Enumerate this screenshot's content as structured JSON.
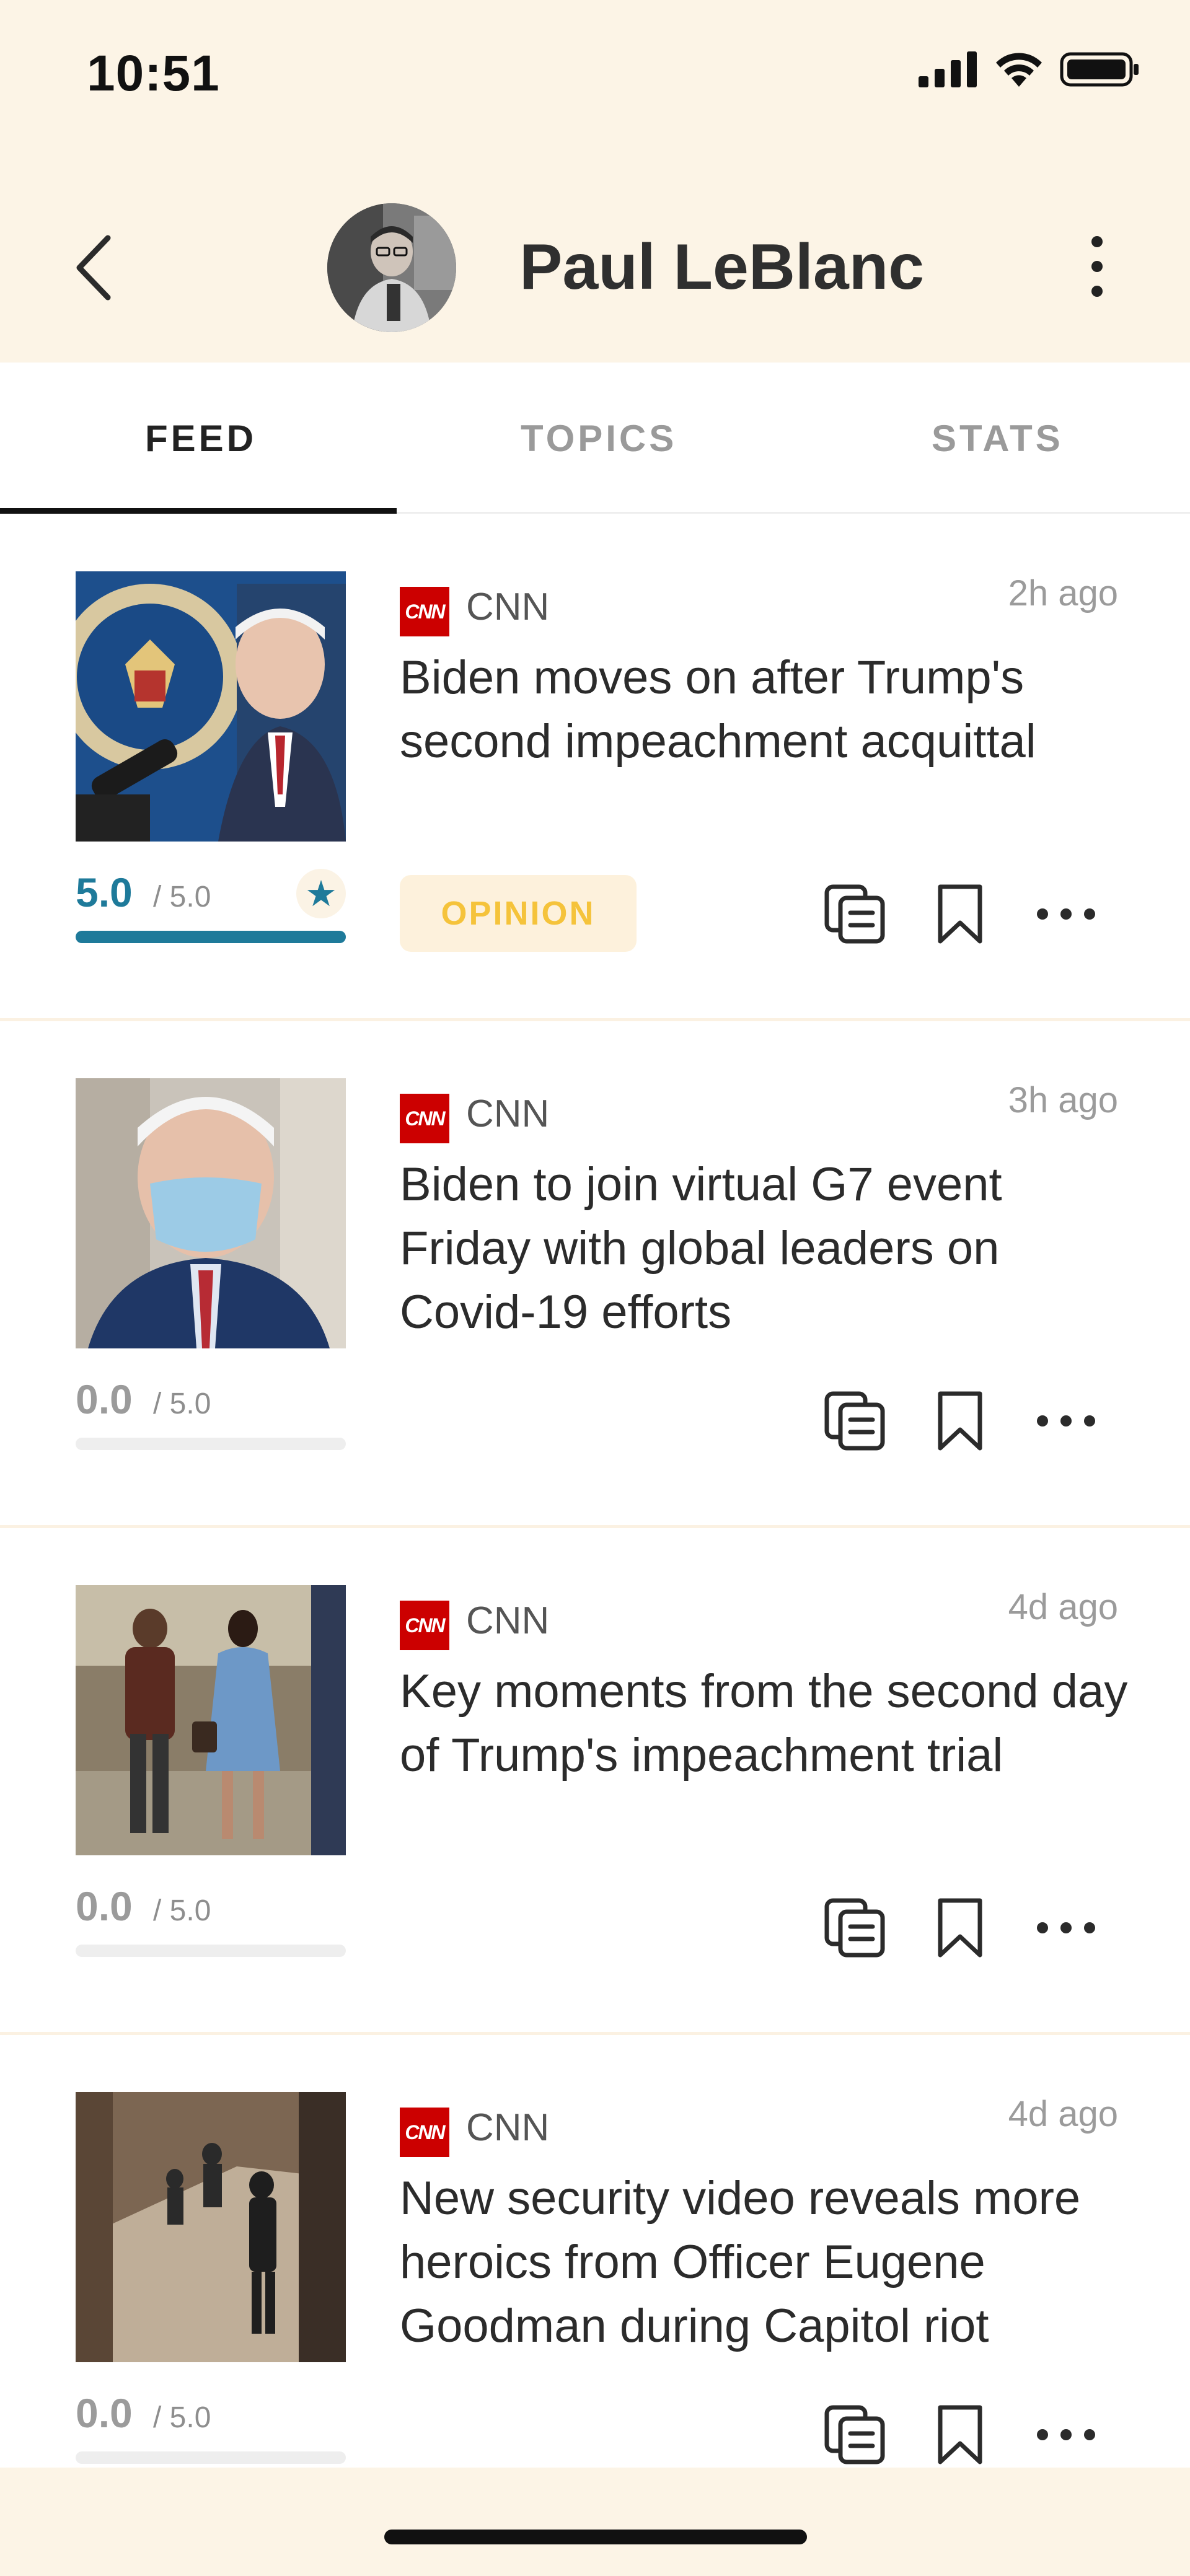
{
  "status_bar": {
    "time": "10:51",
    "icons": [
      "signal-icon",
      "wifi-icon",
      "battery-icon"
    ]
  },
  "header": {
    "back_icon": "chevron-left-icon",
    "profile_name": "Paul LeBlanc",
    "menu_icon": "kebab-menu-icon"
  },
  "tabs": [
    {
      "label": "FEED",
      "active": true
    },
    {
      "label": "TOPICS",
      "active": false
    },
    {
      "label": "STATS",
      "active": false
    }
  ],
  "feed": {
    "items": [
      {
        "source": "CNN",
        "age": "2h ago",
        "title": "Biden moves on after Trump's second impeachment acquittal",
        "score": "5.0",
        "out_of": "/ 5.0",
        "rating_fraction": 1.0,
        "starred": true,
        "badge": "OPINION"
      },
      {
        "source": "CNN",
        "age": "3h ago",
        "title": "Biden to join virtual G7 event Friday with global leaders on Covid-19 efforts",
        "score": "0.0",
        "out_of": "/ 5.0",
        "rating_fraction": 0.0,
        "starred": false,
        "badge": ""
      },
      {
        "source": "CNN",
        "age": "4d ago",
        "title": "Key moments from the second day of Trump's impeachment trial",
        "score": "0.0",
        "out_of": "/ 5.0",
        "rating_fraction": 0.0,
        "starred": false,
        "badge": ""
      },
      {
        "source": "CNN",
        "age": "4d ago",
        "title": "New security video reveals more heroics from Officer Eugene Goodman during Capitol riot",
        "score": "0.0",
        "out_of": "/ 5.0",
        "rating_fraction": 0.0,
        "starred": false,
        "badge": ""
      }
    ],
    "source_logo_text": "CNN",
    "actions": [
      "summary-icon",
      "bookmark-icon",
      "more-options-icon"
    ]
  },
  "colors": {
    "background_cream": "#fcf4e6",
    "accent_teal": "#1e7a9a",
    "badge_yellow": "#f5c33b",
    "cnn_red": "#cc0000"
  }
}
